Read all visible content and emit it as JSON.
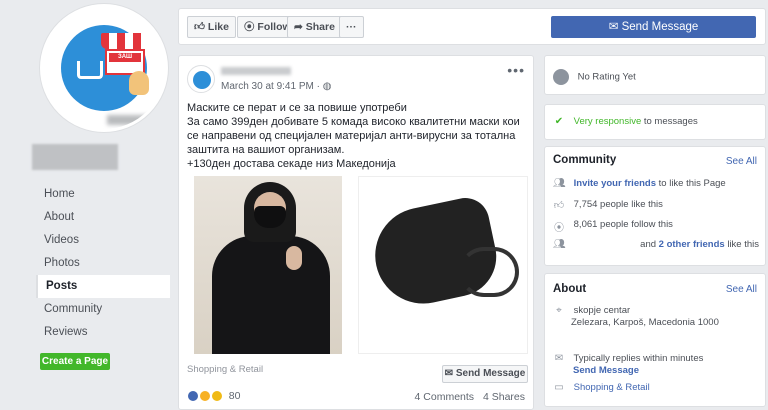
{
  "nav": {
    "items": [
      {
        "label": "Home",
        "active": false
      },
      {
        "label": "About",
        "active": false
      },
      {
        "label": "Videos",
        "active": false
      },
      {
        "label": "Photos",
        "active": false
      },
      {
        "label": "Posts",
        "active": true
      },
      {
        "label": "Community",
        "active": false
      },
      {
        "label": "Reviews",
        "active": false
      }
    ],
    "create_page": "Create a Page"
  },
  "logo": {
    "sign": "ЗАШ"
  },
  "toolbar": {
    "like": "Like",
    "follow": "Follow",
    "share": "Share",
    "more": "···",
    "send_message": "Send Message"
  },
  "post": {
    "date": "March 30 at 9:41 PM",
    "more": "•••",
    "lines": [
      "Маските се перат и се за повише употреби",
      "За само 399ден добивате 5 комада високо квалитетни маски кои се направени од специјален материјал анти-вирусни за тотална заштита на вашиот организам.",
      "+130ден достава секаде низ Македонија"
    ],
    "category": "Shopping & Retail",
    "send_message": "Send Message",
    "reactions_count": "80",
    "comments": "4 Comments",
    "shares": "4 Shares"
  },
  "rating": {
    "text": "No Rating Yet"
  },
  "responsive": {
    "highlight": "Very responsive",
    "rest": "to messages"
  },
  "community": {
    "title": "Community",
    "see_all": "See All",
    "invite_link": "Invite your friends",
    "invite_rest": "to like this Page",
    "likes": "7,754 people like this",
    "follows": "8,061 people follow this",
    "friends_and": "and",
    "friends_link": "2 other friends",
    "friends_rest": "like this"
  },
  "about": {
    "title": "About",
    "see_all": "See All",
    "address_line1": "skopje centar",
    "address_line2": "Zelezara, Karpoš, Macedonia 1000",
    "replies": "Typically replies within minutes",
    "send_message": "Send Message",
    "category": "Shopping & Retail"
  },
  "colors": {
    "accent": "#4267b2",
    "green": "#42b72a",
    "bg": "#e9ebee"
  }
}
